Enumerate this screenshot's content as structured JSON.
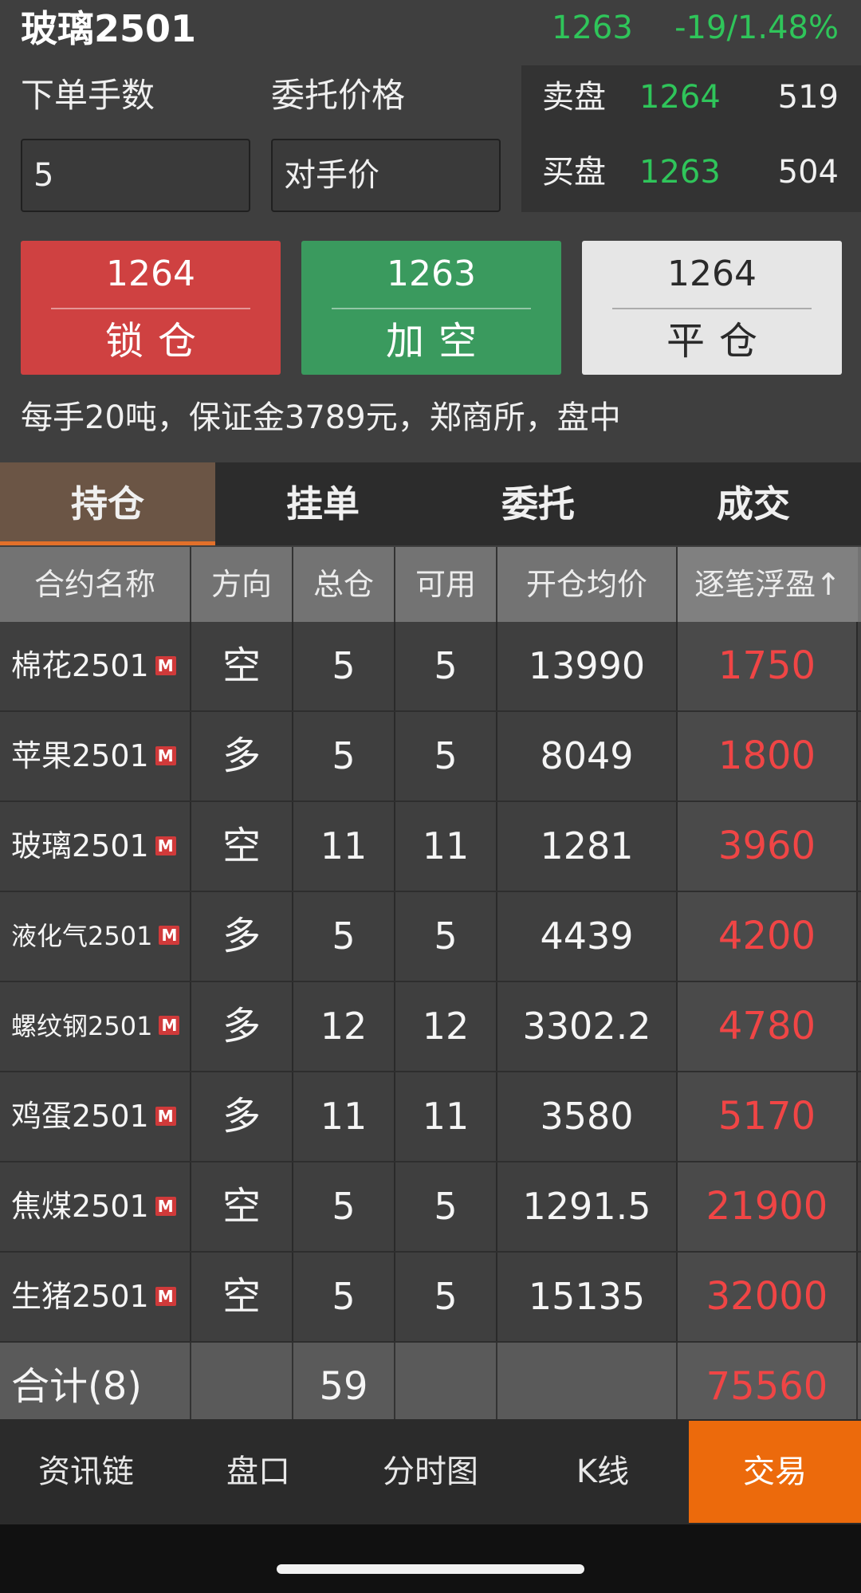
{
  "header": {
    "title": "玻璃2501",
    "last_price": "1263",
    "change": "-19/1.48%"
  },
  "order_form": {
    "qty_label": "下单手数",
    "price_label": "委托价格",
    "qty_value": "5",
    "price_value": "对手价"
  },
  "order_book": {
    "sell_label": "卖盘",
    "sell_price": "1264",
    "sell_volume": "519",
    "buy_label": "买盘",
    "buy_price": "1263",
    "buy_volume": "504"
  },
  "buttons": {
    "lock": {
      "price": "1264",
      "label": "锁仓"
    },
    "short": {
      "price": "1263",
      "label": "加空"
    },
    "close": {
      "price": "1264",
      "label": "平仓"
    }
  },
  "contract_info": "每手20吨，保证金3789元，郑商所，盘中",
  "tabs": [
    "持仓",
    "挂单",
    "委托",
    "成交"
  ],
  "table": {
    "headers": [
      "合约名称",
      "方向",
      "总仓",
      "可用",
      "开仓均价",
      "逐笔浮盈↑"
    ],
    "tag": "M",
    "rows": [
      {
        "name": "棉花2501",
        "dir": "空",
        "total": "5",
        "avail": "5",
        "avg": "13990",
        "pnl": "1750"
      },
      {
        "name": "苹果2501",
        "dir": "多",
        "total": "5",
        "avail": "5",
        "avg": "8049",
        "pnl": "1800"
      },
      {
        "name": "玻璃2501",
        "dir": "空",
        "total": "11",
        "avail": "11",
        "avg": "1281",
        "pnl": "3960"
      },
      {
        "name": "液化气2501",
        "dir": "多",
        "total": "5",
        "avail": "5",
        "avg": "4439",
        "pnl": "4200"
      },
      {
        "name": "螺纹钢2501",
        "dir": "多",
        "total": "12",
        "avail": "12",
        "avg": "3302.2",
        "pnl": "4780"
      },
      {
        "name": "鸡蛋2501",
        "dir": "多",
        "total": "11",
        "avail": "11",
        "avg": "3580",
        "pnl": "5170"
      },
      {
        "name": "焦煤2501",
        "dir": "空",
        "total": "5",
        "avail": "5",
        "avg": "1291.5",
        "pnl": "21900"
      },
      {
        "name": "生猪2501",
        "dir": "空",
        "total": "5",
        "avail": "5",
        "avg": "15135",
        "pnl": "32000"
      }
    ],
    "footer": {
      "label": "合计(8)",
      "total": "59",
      "pnl": "75560"
    }
  },
  "bottom_nav": [
    "资讯链",
    "盘口",
    "分时图",
    "K线",
    "交易"
  ],
  "colors": {
    "green": "#2fc55a",
    "red": "#e84040",
    "accent": "#ec6a0c"
  }
}
